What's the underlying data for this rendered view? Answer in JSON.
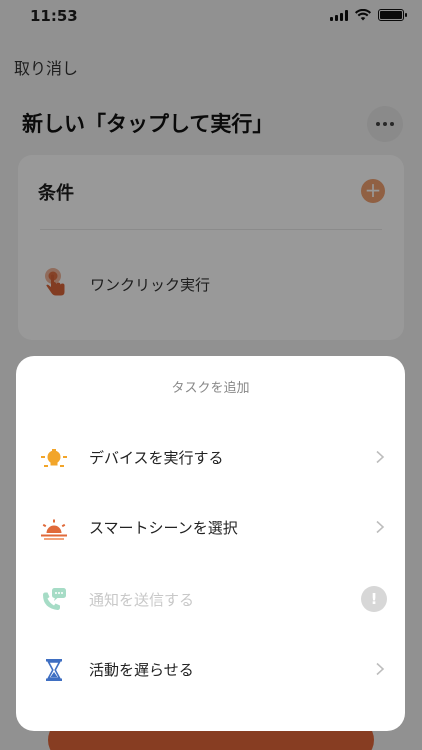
{
  "status_bar": {
    "time": "11:53"
  },
  "header": {
    "cancel_label": "取り消し",
    "title": "新しい「タップして実行」"
  },
  "condition_card": {
    "title": "条件",
    "item_label": "ワンクリック実行"
  },
  "sheet": {
    "title": "タスクを追加",
    "items": [
      {
        "label": "デバイスを実行する",
        "icon": "bulb-icon",
        "enabled": true
      },
      {
        "label": "スマートシーンを選択",
        "icon": "sunrise-icon",
        "enabled": true
      },
      {
        "label": "通知を送信する",
        "icon": "phone-message-icon",
        "enabled": false,
        "badge": "!"
      },
      {
        "label": "活動を遅らせる",
        "icon": "hourglass-icon",
        "enabled": true
      }
    ]
  },
  "colors": {
    "accent": "#e2673a",
    "bulb": "#f2a52a",
    "sunrise": "#e06a3a",
    "hourglass": "#3f6fc2",
    "disabled_icon": "#a6dcc6"
  }
}
